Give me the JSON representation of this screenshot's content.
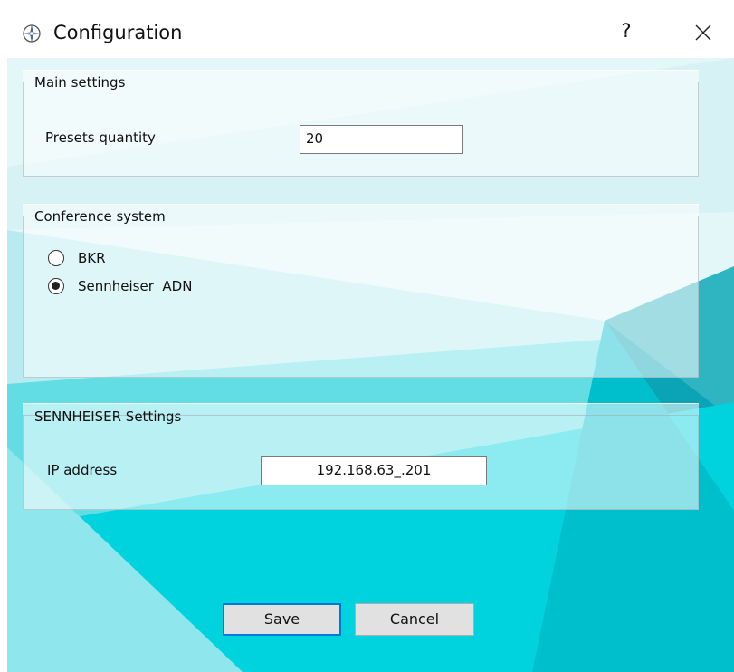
{
  "window": {
    "title": "Configuration",
    "help_label": "?",
    "app_icon": "compass-icon",
    "close_icon": "close-icon"
  },
  "main_settings": {
    "title": "Main settings",
    "presets_label": "Presets quantity",
    "presets_value": "20"
  },
  "conference_system": {
    "title": "Conference system",
    "options": [
      {
        "label": "BKR",
        "selected": false
      },
      {
        "label": "Sennheiser  ADN",
        "selected": true
      }
    ]
  },
  "sennheiser_settings": {
    "title": "SENNHEISER Settings",
    "ip_label": "IP address",
    "ip_value": "192.168.63_.201"
  },
  "buttons": {
    "save": "Save",
    "cancel": "Cancel"
  },
  "colors": {
    "accent": "#0078d7",
    "background_teal": "#00c8d2"
  }
}
